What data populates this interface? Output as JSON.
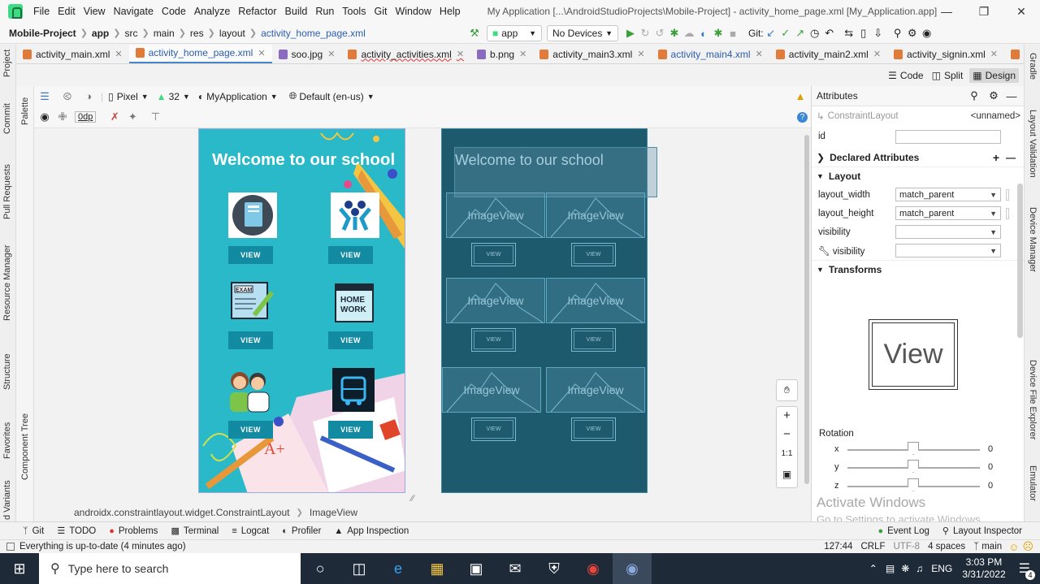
{
  "menubar": {
    "items": [
      "File",
      "Edit",
      "View",
      "Navigate",
      "Code",
      "Analyze",
      "Refactor",
      "Build",
      "Run",
      "Tools",
      "Git",
      "Window",
      "Help"
    ],
    "title": "My Application [...\\AndroidStudioProjects\\Mobile-Project] - activity_home_page.xml [My_Application.app]"
  },
  "navbar": {
    "crumbs": [
      "Mobile-Project",
      "app",
      "src",
      "main",
      "res",
      "layout",
      "activity_home_page.xml"
    ],
    "run_config": "app",
    "device": "No Devices",
    "git_label": "Git:"
  },
  "tabs": [
    {
      "label": "activity_main.xml"
    },
    {
      "label": "activity_home_page.xml"
    },
    {
      "label": "soo.jpg"
    },
    {
      "label": "activity_activities.xml"
    },
    {
      "label": "b.png"
    },
    {
      "label": "activity_main3.xml"
    },
    {
      "label": "activity_main4.xml"
    },
    {
      "label": "activity_main2.xml"
    },
    {
      "label": "activity_signin.xml"
    },
    {
      "label": "acti"
    }
  ],
  "view_modes": {
    "code": "Code",
    "split": "Split",
    "design": "Design"
  },
  "left_strip": [
    "Project",
    "Commit",
    "Pull Requests",
    "Resource Manager",
    "Structure",
    "Favorites",
    "d Variants"
  ],
  "palette_strip": [
    "Palette",
    "Component Tree"
  ],
  "right_strip": [
    "Gradle",
    "Layout Validation",
    "Device Manager",
    "Device File Explorer",
    "Emulator"
  ],
  "design_toolbar": {
    "device": "Pixel",
    "api": "32",
    "theme": "MyApplication",
    "locale": "Default (en-us)",
    "margin": "0dp"
  },
  "phone": {
    "welcome": "Welcome to our school",
    "view_label": "VIEW",
    "icons": [
      "book-icon",
      "teamwork-icon",
      "exam-icon",
      "homework-icon",
      "parents-icon",
      "bus-icon"
    ]
  },
  "blueprint": {
    "welcome": "Welcome to our school",
    "image_label": "ImageView",
    "view_label": "VIEW"
  },
  "zoom": {
    "one_to_one": "1:1"
  },
  "attributes": {
    "title": "Attributes",
    "component": "ConstraintLayout",
    "component_name": "<unnamed>",
    "id_label": "id",
    "declared": "Declared Attributes",
    "layout": "Layout",
    "rows": [
      {
        "label": "layout_width",
        "value": "match_parent"
      },
      {
        "label": "layout_height",
        "value": "match_parent"
      },
      {
        "label": "visibility",
        "value": ""
      },
      {
        "label": "visibility",
        "value": ""
      }
    ],
    "transforms": "Transforms",
    "preview": "View",
    "rotation": "Rotation",
    "axes": [
      {
        "axis": "x",
        "value": "0"
      },
      {
        "axis": "y",
        "value": "0"
      },
      {
        "axis": "z",
        "value": "0"
      }
    ]
  },
  "activate": {
    "line1": "Activate Windows",
    "line2": "Go to Settings to activate Windows."
  },
  "crumbbar": {
    "parent": "androidx.constraintlayout.widget.ConstraintLayout",
    "child": "ImageView"
  },
  "toolwindows": [
    "Git",
    "TODO",
    "Problems",
    "Terminal",
    "Logcat",
    "Profiler",
    "App Inspection"
  ],
  "toolwindows_right": [
    "Event Log",
    "Layout Inspector"
  ],
  "status": {
    "message": "Everything is up-to-date (4 minutes ago)",
    "position": "127:44",
    "line_sep": "CRLF",
    "encoding": "UTF-8",
    "indent": "4 spaces",
    "branch": "main"
  },
  "taskbar": {
    "search_placeholder": "Type here to search",
    "lang": "ENG",
    "time": "3:03 PM",
    "date": "3/31/2022",
    "notif_count": "4"
  },
  "colors": {
    "accent": "#4a86c7",
    "phone_bg": "#29b9c8",
    "blueprint": "#1e5a6e",
    "taskbar": "#1e2a38"
  }
}
